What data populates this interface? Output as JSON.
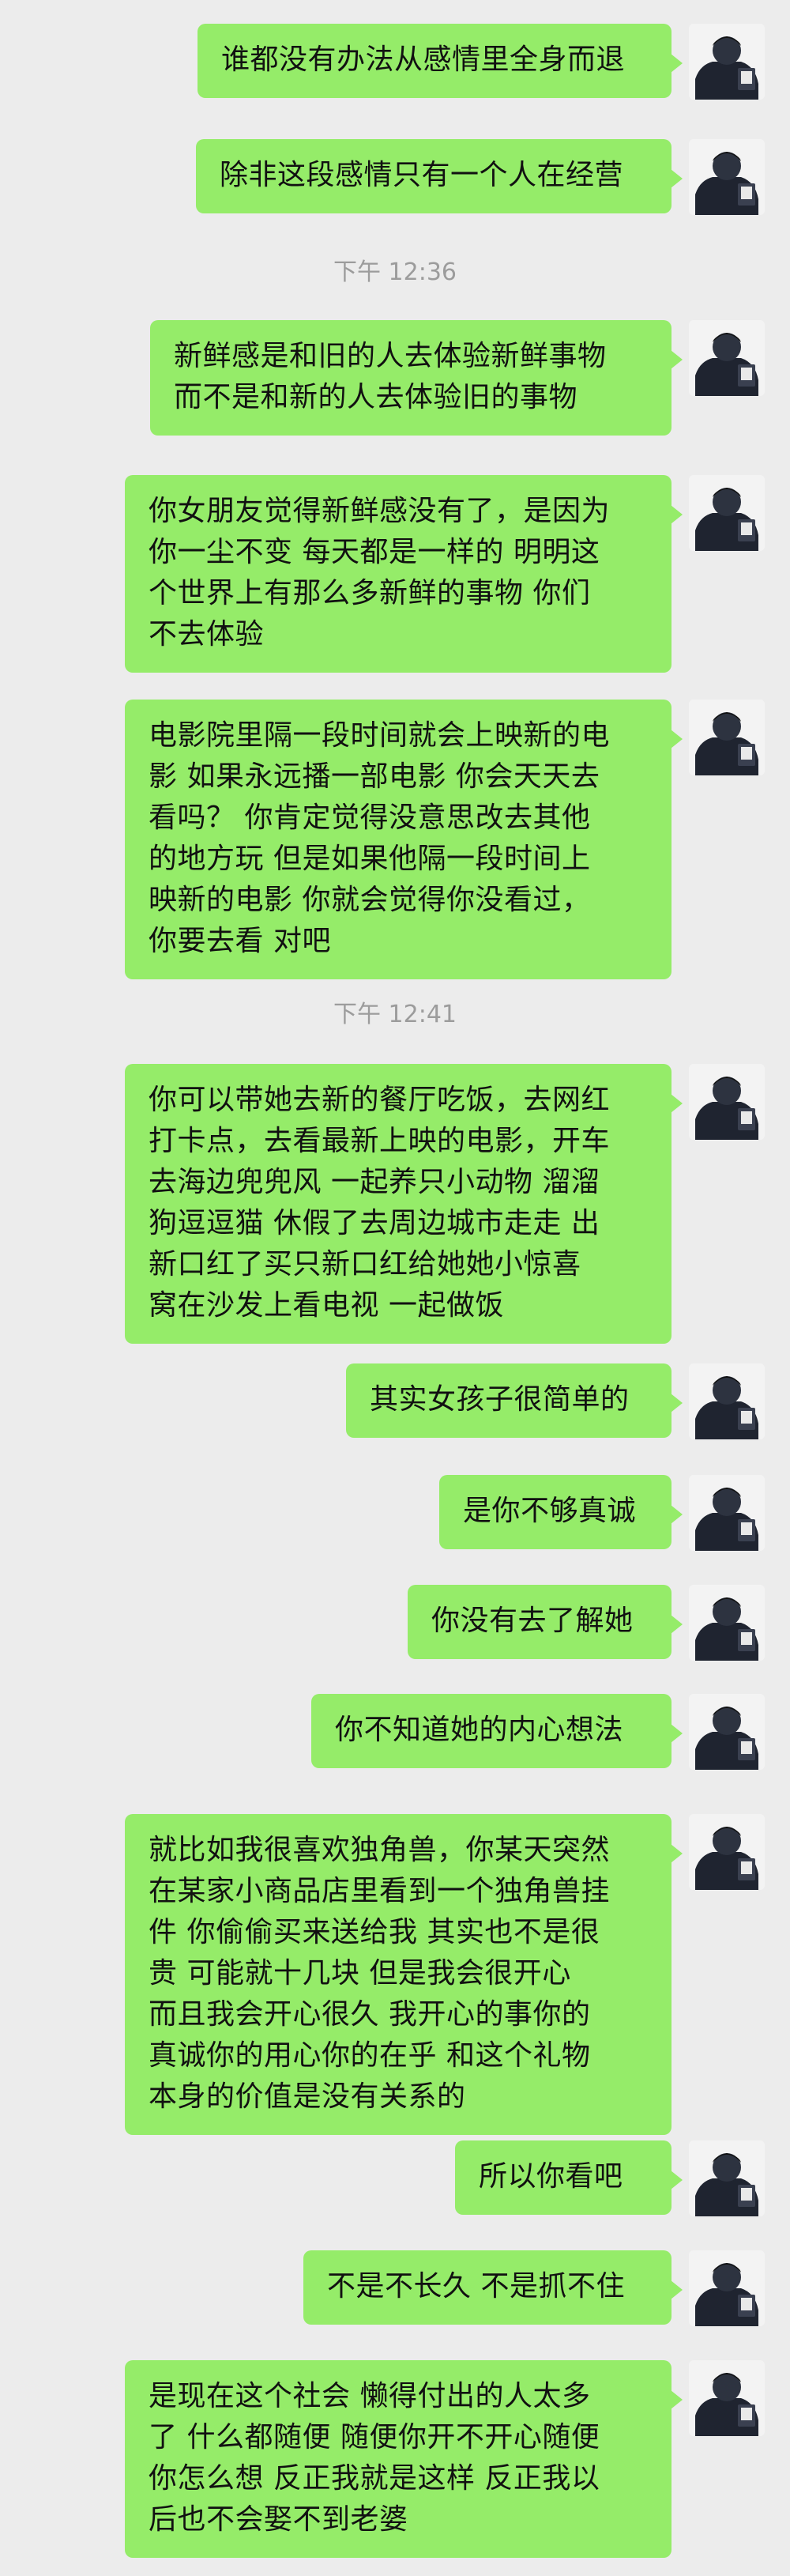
{
  "icons": {
    "avatar": "user-avatar-person-head-down"
  },
  "colors": {
    "background": "#ececec",
    "bubble": "#95ec69",
    "timestamp": "#9c9c9c"
  },
  "timestamps": [
    "下午 12:36",
    "下午 12:41"
  ],
  "messages": [
    {
      "text": "谁都没有办法从感情里全身而退"
    },
    {
      "text": "除非这段感情只有一个人在经营"
    },
    {
      "text": "新鲜感是和旧的人去体验新鲜事物\n而不是和新的人去体验旧的事物"
    },
    {
      "text": "你女朋友觉得新鲜感没有了，是因为\n你一尘不变 每天都是一样的 明明这\n个世界上有那么多新鲜的事物 你们\n不去体验"
    },
    {
      "text": "电影院里隔一段时间就会上映新的电\n影 如果永远播一部电影 你会天天去\n看吗？ 你肯定觉得没意思改去其他\n的地方玩 但是如果他隔一段时间上\n映新的电影 你就会觉得你没看过，\n你要去看 对吧"
    },
    {
      "text": "你可以带她去新的餐厅吃饭，去网红\n打卡点，去看最新上映的电影，开车\n去海边兜兜风 一起养只小动物 溜溜\n狗逗逗猫 休假了去周边城市走走 出\n新口红了买只新口红给她她小惊喜\n窝在沙发上看电视 一起做饭"
    },
    {
      "text": "其实女孩子很简单的"
    },
    {
      "text": "是你不够真诚"
    },
    {
      "text": "你没有去了解她"
    },
    {
      "text": "你不知道她的内心想法"
    },
    {
      "text": "就比如我很喜欢独角兽，你某天突然\n在某家小商品店里看到一个独角兽挂\n件 你偷偷买来送给我 其实也不是很\n贵 可能就十几块 但是我会很开心\n而且我会开心很久  我开心的事你的\n真诚你的用心你的在乎 和这个礼物\n本身的价值是没有关系的"
    },
    {
      "text": "所以你看吧"
    },
    {
      "text": "不是不长久 不是抓不住"
    },
    {
      "text": "是现在这个社会 懒得付出的人太多\n了 什么都随便 随便你开不开心随便\n你怎么想 反正我就是这样 反正我以\n后也不会娶不到老婆"
    }
  ]
}
